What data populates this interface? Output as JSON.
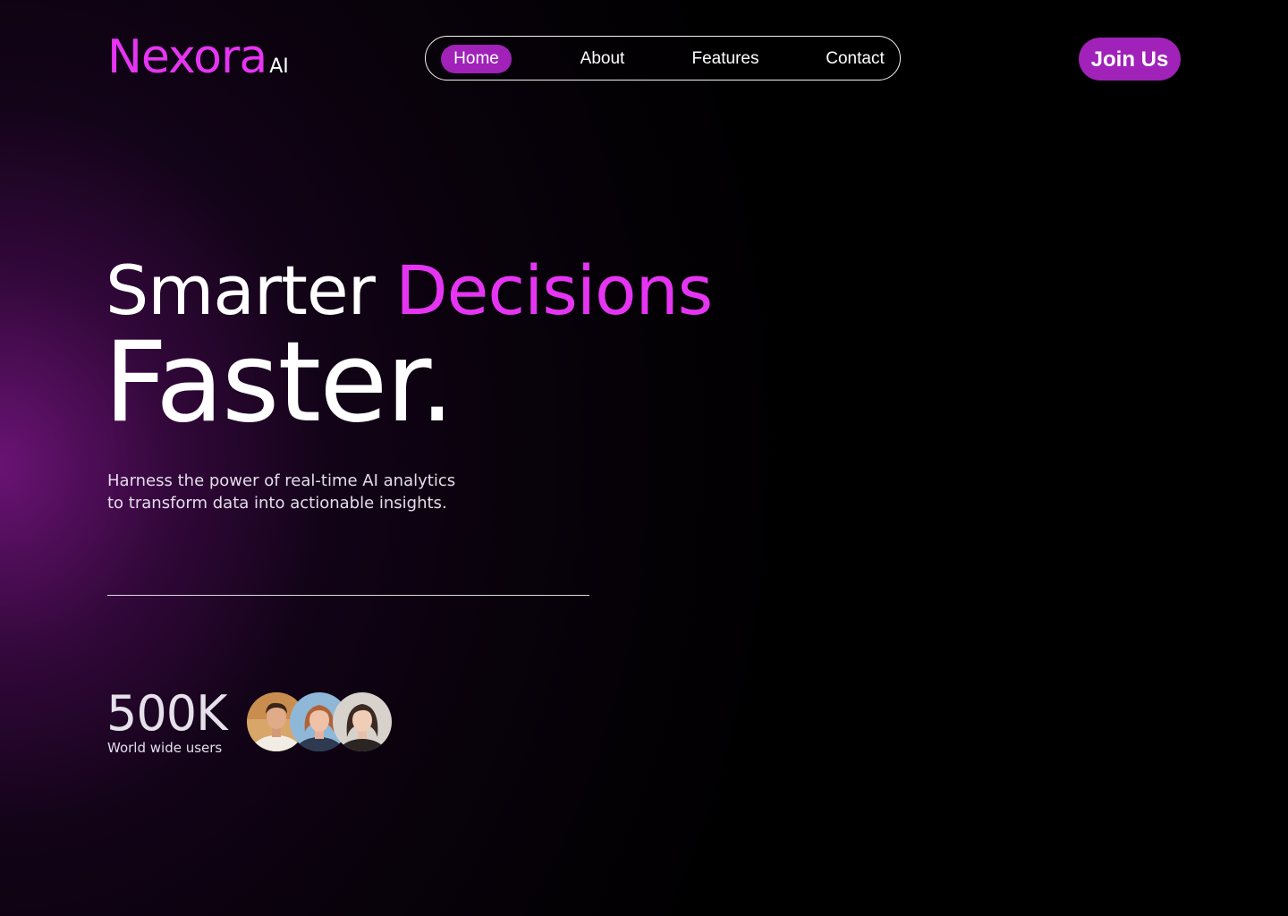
{
  "colors": {
    "background": "#000000",
    "accent": "#e535f2",
    "button": "#a022b8",
    "text": "#ffffff"
  },
  "brand": {
    "name": "Nexora",
    "suffix": "AI"
  },
  "nav": {
    "items": [
      {
        "label": "Home",
        "active": true
      },
      {
        "label": "About",
        "active": false
      },
      {
        "label": "Features",
        "active": false
      },
      {
        "label": "Contact",
        "active": false
      }
    ]
  },
  "header": {
    "cta_label": "Join Us"
  },
  "hero": {
    "headline_part1": "Smarter",
    "headline_accent": "Decisions",
    "headline_line2": "Faster.",
    "subtitle_line1": "Harness the power of real-time AI analytics",
    "subtitle_line2": "to transform data into actionable insights."
  },
  "stats": {
    "value": "500K",
    "label": "World wide users"
  },
  "avatars": [
    {
      "icon": "user-avatar-male"
    },
    {
      "icon": "user-avatar-female-redhair"
    },
    {
      "icon": "user-avatar-female-darkhair"
    }
  ]
}
